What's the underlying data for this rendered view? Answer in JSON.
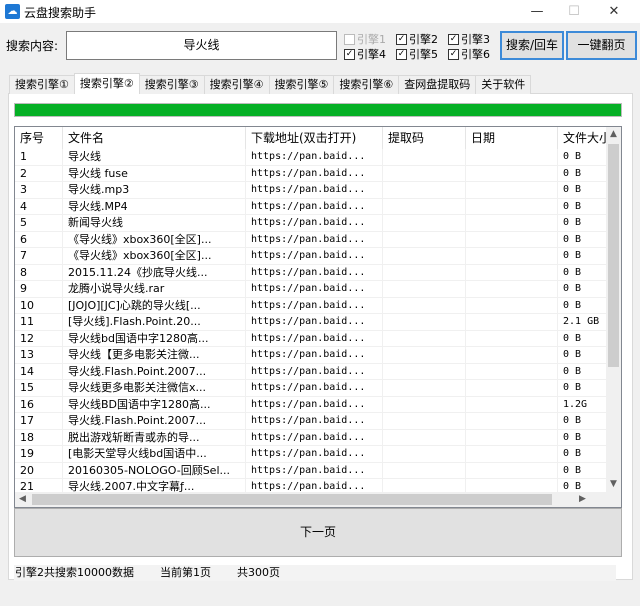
{
  "window": {
    "title": "云盘搜索助手",
    "minimize": "—",
    "maximize": "☐",
    "close": "✕"
  },
  "search": {
    "label": "搜索内容:",
    "value": "导火线",
    "search_button": "搜索/回车",
    "page_all_button": "一键翻页"
  },
  "engines": [
    {
      "label": "引擎1",
      "checked": false,
      "disabled": true
    },
    {
      "label": "引擎2",
      "checked": true
    },
    {
      "label": "引擎3",
      "checked": true
    },
    {
      "label": "引擎4",
      "checked": true
    },
    {
      "label": "引擎5",
      "checked": true
    },
    {
      "label": "引擎6",
      "checked": true
    }
  ],
  "tabs": [
    "搜索引擎①",
    "搜索引擎②",
    "搜索引擎③",
    "搜索引擎④",
    "搜索引擎⑤",
    "搜索引擎⑥",
    "查网盘提取码",
    "关于软件"
  ],
  "active_tab": 1,
  "progress": 100,
  "table": {
    "columns": [
      "序号",
      "文件名",
      "下载地址(双击打开)",
      "提取码",
      "日期",
      "文件大小"
    ],
    "rows": [
      [
        "1",
        "导火线",
        "https://pan.baid...",
        "",
        "",
        "0 B"
      ],
      [
        "2",
        "导火线 fuse",
        "https://pan.baid...",
        "",
        "",
        "0 B"
      ],
      [
        "3",
        "导火线.mp3",
        "https://pan.baid...",
        "",
        "",
        "0 B"
      ],
      [
        "4",
        "导火线.MP4",
        "https://pan.baid...",
        "",
        "",
        "0 B"
      ],
      [
        "5",
        "新闻导火线",
        "https://pan.baid...",
        "",
        "",
        "0 B"
      ],
      [
        "6",
        "《导火线》xbox360[全区]...",
        "https://pan.baid...",
        "",
        "",
        "0 B"
      ],
      [
        "7",
        "《导火线》xbox360[全区]...",
        "https://pan.baid...",
        "",
        "",
        "0 B"
      ],
      [
        "8",
        "2015.11.24《抄底导火线...",
        "https://pan.baid...",
        "",
        "",
        "0 B"
      ],
      [
        "9",
        "龙腾小说导火线.rar",
        "https://pan.baid...",
        "",
        "",
        "0 B"
      ],
      [
        "10",
        "[JOJO][JC]心跳的导火线[...",
        "https://pan.baid...",
        "",
        "",
        "0 B"
      ],
      [
        "11",
        "[导火线].Flash.Point.20...",
        "https://pan.baid...",
        "",
        "",
        "2.1 GB"
      ],
      [
        "12",
        "导火线bd国语中字1280高...",
        "https://pan.baid...",
        "",
        "",
        "0 B"
      ],
      [
        "13",
        "导火线【更多电影关注微...",
        "https://pan.baid...",
        "",
        "",
        "0 B"
      ],
      [
        "14",
        "导火线.Flash.Point.2007...",
        "https://pan.baid...",
        "",
        "",
        "0 B"
      ],
      [
        "15",
        "导火线更多电影关注微信x...",
        "https://pan.baid...",
        "",
        "",
        "0 B"
      ],
      [
        "16",
        "导火线BD国语中字1280高...",
        "https://pan.baid...",
        "",
        "",
        "1.2G"
      ],
      [
        "17",
        "导火线.Flash.Point.2007...",
        "https://pan.baid...",
        "",
        "",
        "0 B"
      ],
      [
        "18",
        "脱出游戏斩断青或赤的导...",
        "https://pan.baid...",
        "",
        "",
        "0 B"
      ],
      [
        "19",
        "[电影天堂导火线bd国语中...",
        "https://pan.baid...",
        "",
        "",
        "0 B"
      ],
      [
        "20",
        "20160305-NOLOGO-回顾Sel...",
        "https://pan.baid...",
        "",
        "",
        "0 B"
      ],
      [
        "21",
        "导火线.2007.中文字幕ƒ...",
        "https://pan.baid...",
        "",
        "",
        "0 B"
      ]
    ]
  },
  "next_page": "下一页",
  "status": {
    "summary": "引擎2共搜索10000数据",
    "current": "当前第1页",
    "total": "共300页"
  },
  "colors": {
    "progress": "#06b025",
    "accent": "#3c8ad8"
  }
}
